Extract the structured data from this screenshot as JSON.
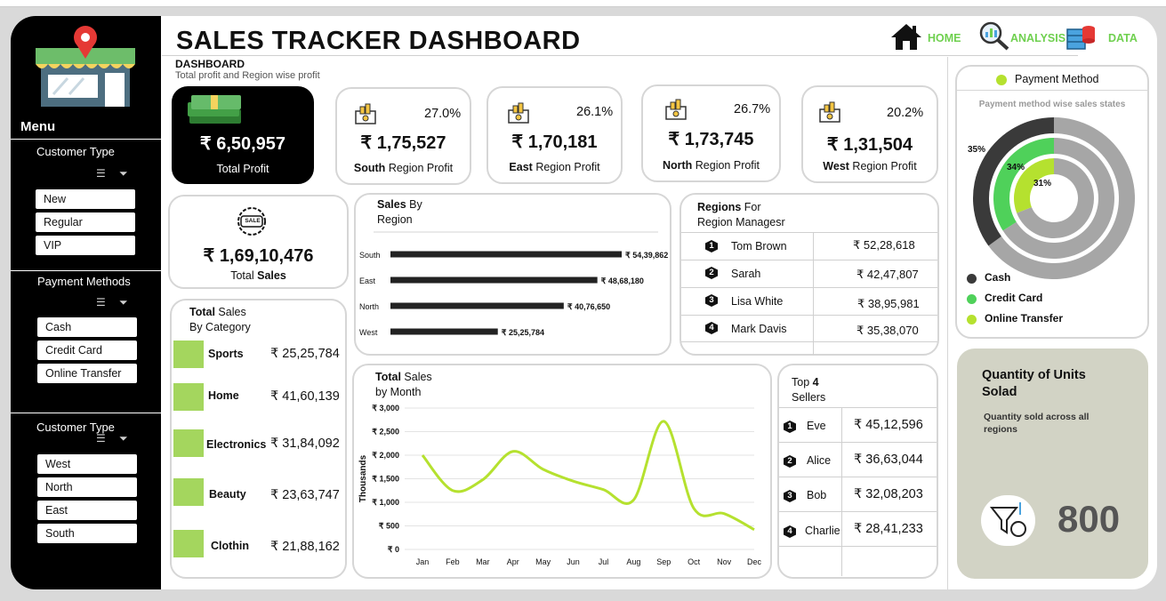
{
  "title": "SALES TRACKER DASHBOARD",
  "subtitle_heading": "DASHBOARD",
  "subtitle_text": "Total profit and Region wise profit",
  "nav": {
    "home": "HOME",
    "analysis": "ANALYSIS",
    "data": "DATA"
  },
  "sidebar": {
    "menu": "Menu",
    "customer_type_label": "Customer Type",
    "customer_types": [
      "New",
      "Regular",
      "VIP"
    ],
    "payment_methods_label": "Payment Methods",
    "payment_methods": [
      "Cash",
      "Credit Card",
      "Online Transfer"
    ],
    "region_label": "Customer Type",
    "regions": [
      "West",
      "North",
      "East",
      "South"
    ]
  },
  "total_profit": {
    "amount": "₹ 6,50,957",
    "label": "Total Profit"
  },
  "region_profits": [
    {
      "pct": "27.0%",
      "amount": "₹ 1,75,527",
      "name": "South",
      "suffix": "Region Profit"
    },
    {
      "pct": "26.1%",
      "amount": "₹ 1,70,181",
      "name": "East",
      "suffix": "Region Profit"
    },
    {
      "pct": "26.7%",
      "amount": "₹ 1,73,745",
      "name": "North",
      "suffix": "Region Profit"
    },
    {
      "pct": "20.2%",
      "amount": "₹ 1,31,504",
      "name": "West",
      "suffix": "Region Profit"
    }
  ],
  "total_sales": {
    "badge": "SALE",
    "amount": "₹ 1,69,10,476",
    "label_a": "Total",
    "label_b": "Sales"
  },
  "sales_by_category": {
    "title_bold": "Total",
    "title_rest": "Sales",
    "title_line2": "By Category",
    "items": [
      {
        "name": "Sports",
        "amount": "₹ 25,25,784"
      },
      {
        "name": "Home",
        "amount": "₹ 41,60,139"
      },
      {
        "name": "Electronics",
        "amount": "₹ 31,84,092"
      },
      {
        "name": "Beauty",
        "amount": "₹ 23,63,747"
      },
      {
        "name": "Clothin",
        "amount": "₹ 21,88,162"
      }
    ]
  },
  "regions_for_managers": {
    "title_bold": "Regions",
    "title_rest": "For",
    "title_line2": "Region Managesr",
    "rows": [
      {
        "rank": "1",
        "name": "Tom Brown",
        "amount": "₹ 52,28,618"
      },
      {
        "rank": "2",
        "name": "Sarah",
        "amount": "₹ 42,47,807"
      },
      {
        "rank": "3",
        "name": "Lisa White",
        "amount": "₹ 38,95,981"
      },
      {
        "rank": "4",
        "name": "Mark Davis",
        "amount": "₹ 35,38,070"
      }
    ]
  },
  "top_sellers": {
    "title_pre": "Top",
    "title_num": "4",
    "title_line2": "Sellers",
    "rows": [
      {
        "rank": "1",
        "name": "Eve",
        "amount": "₹ 45,12,596"
      },
      {
        "rank": "2",
        "name": "Alice",
        "amount": "₹ 36,63,044"
      },
      {
        "rank": "3",
        "name": "Bob",
        "amount": "₹ 32,08,203"
      },
      {
        "rank": "4",
        "name": "Charlie",
        "amount": "₹ 28,41,233"
      }
    ]
  },
  "payment_panel": {
    "legend_title": "Payment Method",
    "chart_title": "Payment method wise sales states",
    "legend": [
      "Cash",
      "Credit Card",
      "Online Transfer"
    ]
  },
  "quantity": {
    "title": "Quantity of Units Solad",
    "subtitle": "Quantity sold across all regions",
    "value": "800"
  },
  "colors": {
    "accent_green": "#a4d65e",
    "lime": "#b5e12f",
    "mid_green": "#4fd15a",
    "dark_ring": "#3a3a3a",
    "grey_ring": "#a6a6a6",
    "nav_green": "#6fd04f"
  },
  "chart_data": [
    {
      "type": "bar",
      "title": "Sales By Region",
      "orientation": "horizontal",
      "categories": [
        "South",
        "East",
        "North",
        "West"
      ],
      "values": [
        5439862,
        4868180,
        4076650,
        2525784
      ],
      "data_labels": [
        "₹ 54,39,862",
        "₹ 48,68,180",
        "₹ 40,76,650",
        "₹ 25,25,784"
      ],
      "color": "#222222"
    },
    {
      "type": "line",
      "title": "Total Sales by Month",
      "ylabel": "Thousands",
      "x": [
        "Jan",
        "Feb",
        "Mar",
        "Apr",
        "May",
        "Jun",
        "Jul",
        "Aug",
        "Sep",
        "Oct",
        "Nov",
        "Dec"
      ],
      "values": [
        2000,
        1250,
        1480,
        2080,
        1700,
        1450,
        1270,
        1050,
        2720,
        870,
        760,
        420
      ],
      "yticks": [
        "₹ 0",
        "₹ 500",
        "₹ 1,000",
        "₹ 1,500",
        "₹ 2,000",
        "₹ 2,500",
        "₹ 3,000"
      ],
      "ylim": [
        0,
        3000
      ],
      "grid": true,
      "color": "#b5e12f"
    },
    {
      "type": "pie",
      "variant": "doughnut",
      "title": "Payment method wise sales states",
      "series": [
        {
          "name": "Cash",
          "value": 35,
          "label": "35%",
          "color": "#3a3a3a"
        },
        {
          "name": "Credit Card",
          "value": 34,
          "label": "34%",
          "color": "#4fd15a"
        },
        {
          "name": "Online Transfer",
          "value": 31,
          "label": "31%",
          "color": "#b5e12f"
        }
      ],
      "remainder_color": "#a6a6a6",
      "legend_position": "bottom-left"
    }
  ]
}
